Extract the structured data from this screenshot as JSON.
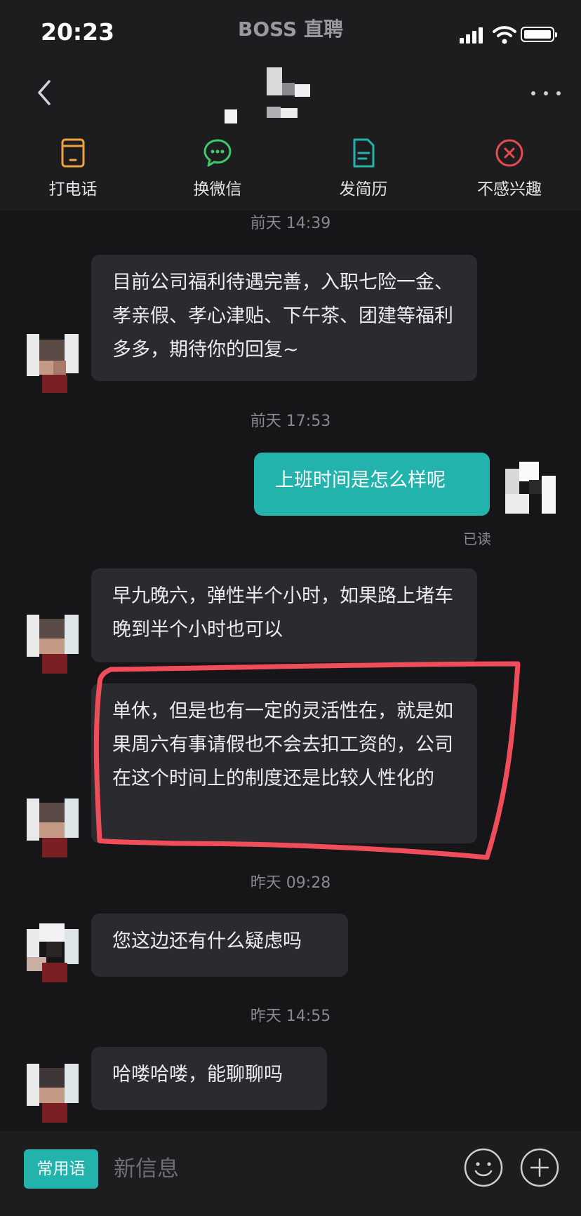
{
  "status_bar": {
    "time": "20:23",
    "app_name": "BOSS 直聘"
  },
  "actions": [
    {
      "label": "打电话",
      "icon": "phone-icon",
      "color": "#f0a33c"
    },
    {
      "label": "换微信",
      "icon": "wechat-icon",
      "color": "#3ec96a"
    },
    {
      "label": "发简历",
      "icon": "resume-icon",
      "color": "#22b3ad"
    },
    {
      "label": "不感兴趣",
      "icon": "not-interested-icon",
      "color": "#e84b4b"
    }
  ],
  "chat": {
    "timestamps": [
      "前天 14:39",
      "前天 17:53",
      "昨天 09:28",
      "昨天 14:55"
    ],
    "messages": [
      {
        "from": "recruiter",
        "text": "目前公司福利待遇完善，入职七险一金、孝亲假、孝心津贴、下午茶、团建等福利多多，期待你的回复~"
      },
      {
        "from": "me",
        "text": "上班时间是怎么样呢"
      },
      {
        "from": "recruiter",
        "text": "早九晚六，弹性半个小时，如果路上堵车晚到半个小时也可以"
      },
      {
        "from": "recruiter",
        "text": "单休，但是也有一定的灵活性在，就是如果周六有事请假也不会去扣工资的，公司在这个时间上的制度还是比较人性化的"
      },
      {
        "from": "recruiter",
        "text": "您这边还有什么疑虑吗"
      },
      {
        "from": "recruiter",
        "text": "哈喽哈喽，能聊聊吗"
      }
    ],
    "read_status": "已读"
  },
  "input": {
    "phrases_label": "常用语",
    "placeholder": "新信息"
  },
  "colors": {
    "accent": "#22b3ad",
    "highlight": "#ef4d5a",
    "bubble": "#2b2b2f",
    "background": "#161618"
  }
}
